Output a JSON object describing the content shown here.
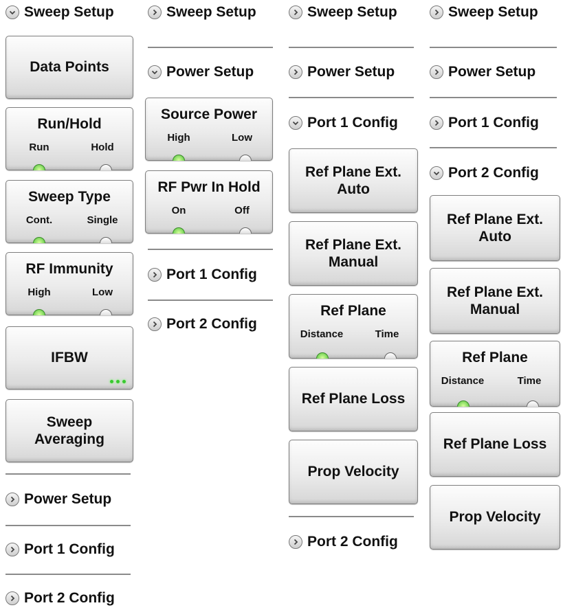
{
  "columns": [
    {
      "sections": {
        "sweep_setup": "Sweep Setup",
        "power_setup": "Power Setup",
        "port1_config": "Port 1 Config",
        "port2_config": "Port 2 Config"
      },
      "buttons": {
        "data_points": "Data Points",
        "run_hold": {
          "title": "Run/Hold",
          "left": "Run",
          "right": "Hold",
          "active": "left"
        },
        "sweep_type": {
          "title": "Sweep Type",
          "left": "Cont.",
          "right": "Single",
          "active": "left"
        },
        "rf_immunity": {
          "title": "RF Immunity",
          "left": "High",
          "right": "Low",
          "active": "left"
        },
        "ifbw": "IFBW",
        "sweep_averaging": "Sweep\nAveraging"
      }
    },
    {
      "sections": {
        "sweep_setup": "Sweep Setup",
        "power_setup": "Power Setup",
        "port1_config": "Port 1 Config",
        "port2_config": "Port 2 Config"
      },
      "buttons": {
        "source_power": {
          "title": "Source Power",
          "left": "High",
          "right": "Low",
          "active": "left"
        },
        "rf_pwr_in_hold": {
          "title": "RF Pwr In Hold",
          "left": "On",
          "right": "Off",
          "active": "left"
        }
      }
    },
    {
      "sections": {
        "sweep_setup": "Sweep Setup",
        "power_setup": "Power Setup",
        "port1_config": "Port 1 Config",
        "port2_config": "Port 2 Config"
      },
      "buttons": {
        "ref_plane_ext_auto": "Ref Plane Ext.\nAuto",
        "ref_plane_ext_manual": "Ref Plane Ext.\nManual",
        "ref_plane": {
          "title": "Ref Plane",
          "left": "Distance",
          "right": "Time",
          "active": "left"
        },
        "ref_plane_loss": "Ref Plane Loss",
        "prop_velocity": "Prop Velocity"
      }
    },
    {
      "sections": {
        "sweep_setup": "Sweep Setup",
        "power_setup": "Power Setup",
        "port1_config": "Port 1 Config",
        "port2_config": "Port 2 Config"
      },
      "buttons": {
        "ref_plane_ext_auto": "Ref Plane Ext.\nAuto",
        "ref_plane_ext_manual": "Ref Plane Ext.\nManual",
        "ref_plane": {
          "title": "Ref Plane",
          "left": "Distance",
          "right": "Time",
          "active": "left"
        },
        "ref_plane_loss": "Ref Plane Loss",
        "prop_velocity": "Prop Velocity"
      }
    }
  ],
  "colors": {
    "led_on": "#4fc23a",
    "led_off": "#e0e0e0",
    "divider": "#8a8a8a",
    "button_border": "#7e7e7e"
  },
  "icons": {
    "expanded": "chevron-down-icon",
    "collapsed": "chevron-right-icon"
  }
}
